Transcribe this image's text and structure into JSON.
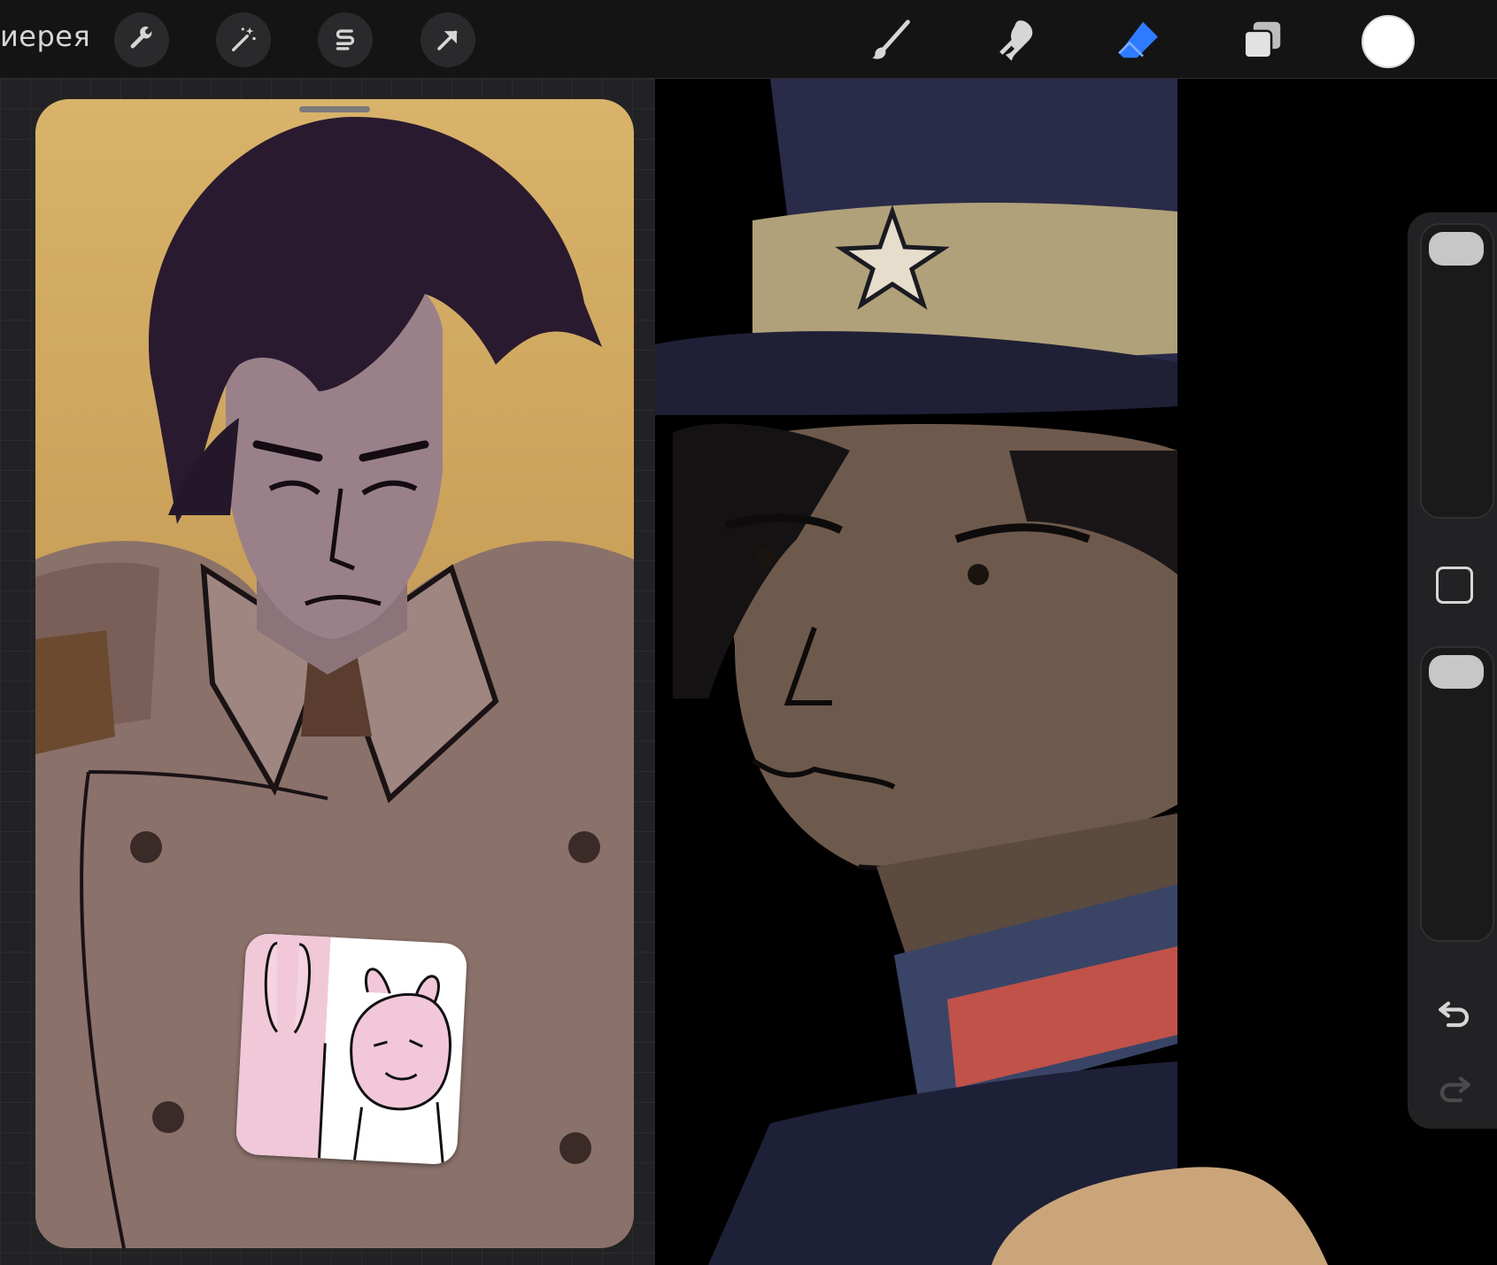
{
  "toolbar": {
    "gallery_label": "иерея",
    "tools_left": [
      "wrench-icon",
      "magic-wand-icon",
      "selection-s-icon",
      "transform-arrow-icon"
    ],
    "tools_right": [
      "brush-icon",
      "smudge-icon",
      "eraser-icon",
      "layers-icon"
    ],
    "active_tool": "eraser-icon",
    "active_color": "#ffffff",
    "accent": "#2f7bff"
  },
  "sidebar": {
    "brush_size_level": 0.0,
    "opacity_level": 0.0,
    "buttons": [
      "modify-square-icon",
      "undo-icon",
      "redo-icon"
    ]
  }
}
